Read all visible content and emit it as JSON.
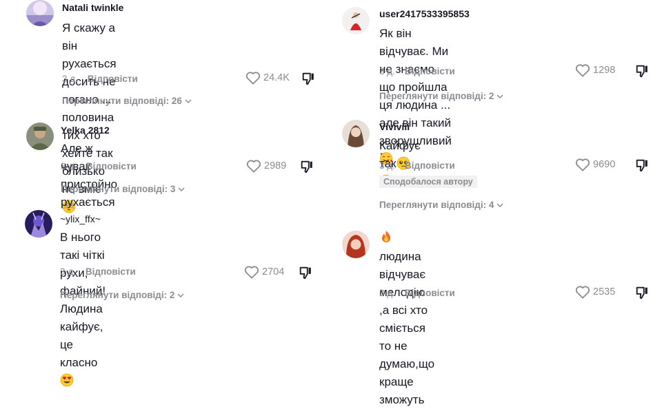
{
  "left": [
    {
      "username": "Natali twinkle",
      "text_lines": [
        "Я скажу а він рухається досить не погано ...",
        "половина тих хто хейте так близько не вміє"
      ],
      "emoji": "flushed-face",
      "age": "3 д.",
      "reply_label": "Відповісти",
      "likes": "24.4K",
      "view_replies": "Переглянути відповіді: 26"
    },
    {
      "username": "Yelka 2812",
      "text_lines": [
        "Але ж чувак пристойно рухається"
      ],
      "age": "3 д.",
      "reply_label": "Відповісти",
      "likes": "2989",
      "view_replies": "Переглянути відповіді: 3"
    },
    {
      "username": "~ylix_ffx~",
      "text_lines": [
        "В нього такі чіткі рухи, файний! Людина",
        "кайфує, це класно"
      ],
      "emoji": "heart-eyes-face",
      "age": "3 д.",
      "reply_label": "Відповісти",
      "likes": "2704",
      "view_replies": "Переглянути відповіді: 2"
    }
  ],
  "right": [
    {
      "username": "user2417533395853",
      "text_lines": [
        "Як він відчуває. Ми не знаємо що пройшла",
        "ця людина ... але він такий зворушливий"
      ],
      "emoji": "smiling-face-with-hearts",
      "age": "3 д.",
      "reply_label": "Відповісти",
      "likes": "1298",
      "view_replies": "Переглянути відповіді: 2"
    },
    {
      "username": "Vivivііі",
      "text_lines": [
        "Кайфує так"
      ],
      "emoji": "pleading-face",
      "age": "3 д.",
      "reply_label": "Відповісти",
      "likes": "9690",
      "badge": "Сподобалося автору",
      "view_replies": "Переглянути відповіді: 4"
    },
    {
      "username_emoji": "fire",
      "text_lines": [
        "людина відчуває мелодію ,а всі хто сміється",
        "то не думаю,що краще зможуть"
      ],
      "age": "3 д.",
      "reply_label": "Відповісти",
      "likes": "2535"
    }
  ],
  "colors": {
    "text": "#161823",
    "muted": "#8a8b91",
    "badge_bg": "#f1f1f2"
  }
}
